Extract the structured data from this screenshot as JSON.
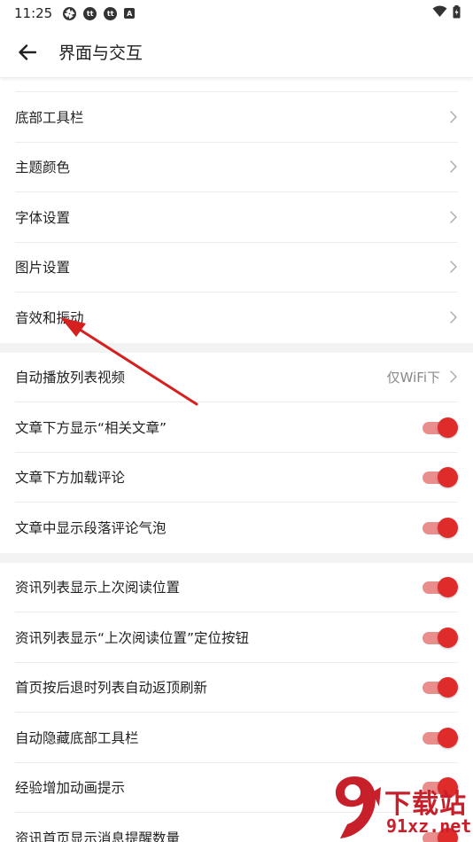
{
  "status_bar": {
    "time": "11:25",
    "icons": [
      "aperture-icon",
      "toutiao-icon",
      "toutiao-icon",
      "a-icon"
    ],
    "toutiao_glyph": "tt",
    "a_glyph": "A"
  },
  "app_bar": {
    "title": "界面与交互",
    "back_icon": "arrow-left-icon"
  },
  "groups": [
    {
      "items": [
        {
          "label": "底部工具栏",
          "type": "nav"
        },
        {
          "label": "主题颜色",
          "type": "nav"
        },
        {
          "label": "字体设置",
          "type": "nav"
        },
        {
          "label": "图片设置",
          "type": "nav"
        },
        {
          "label": "音效和振动",
          "type": "nav"
        }
      ]
    },
    {
      "items": [
        {
          "label": "自动播放列表视频",
          "type": "nav",
          "value": "仅WiFi下"
        },
        {
          "label": "文章下方显示“相关文章”",
          "type": "toggle",
          "on": true
        },
        {
          "label": "文章下方加载评论",
          "type": "toggle",
          "on": true
        },
        {
          "label": "文章中显示段落评论气泡",
          "type": "toggle",
          "on": true
        }
      ]
    },
    {
      "items": [
        {
          "label": "资讯列表显示上次阅读位置",
          "type": "toggle",
          "on": true
        },
        {
          "label": "资讯列表显示“上次阅读位置”定位按钮",
          "type": "toggle",
          "on": true
        },
        {
          "label": "首页按后退时列表自动返顶刷新",
          "type": "toggle",
          "on": true
        },
        {
          "label": "自动隐藏底部工具栏",
          "type": "toggle",
          "on": true
        },
        {
          "label": "经验增加动画提示",
          "type": "toggle",
          "on": true
        },
        {
          "label": "资讯首页显示消息提醒数量",
          "type": "toggle",
          "on": true
        }
      ]
    }
  ],
  "annotation": {
    "type": "red-arrow",
    "color": "#d62020"
  },
  "watermark": {
    "text": "下载站",
    "url": "91xz.net"
  },
  "colors": {
    "accent": "#e02b2b",
    "track": "#e98d8d",
    "divider": "#ececec",
    "section_bg": "#f3f3f3"
  }
}
